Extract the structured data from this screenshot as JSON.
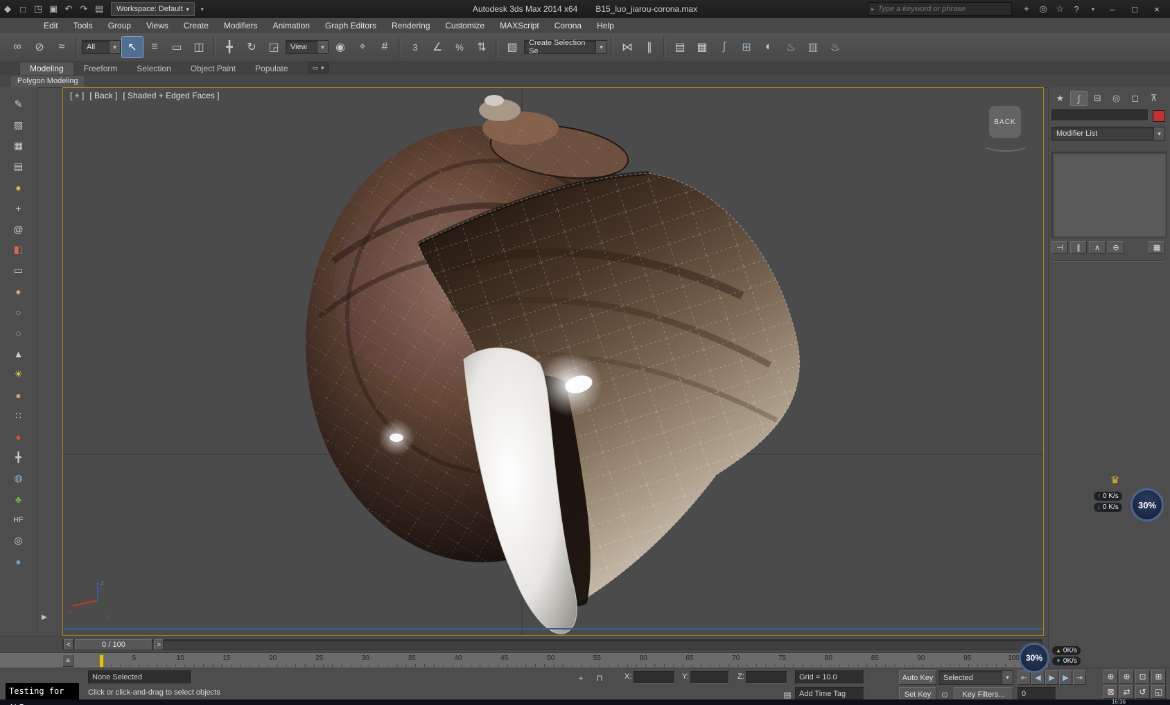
{
  "title_bar": {
    "app_title": "Autodesk 3ds Max 2014 x64",
    "file_name": "B15_luo_jiarou-corona.max",
    "workspace": "Workspace: Default",
    "search_placeholder": "Type a keyword or phrase",
    "search_icon": "▸",
    "qat": {
      "app": "◆",
      "new": "□",
      "open": "◳",
      "save": "▣",
      "undo": "↶",
      "redo": "↷",
      "folder": "▤",
      "dropdown": "▾"
    },
    "info": {
      "target": "⌖",
      "community": "◎",
      "star": "☆",
      "help": "?",
      "chevron": "▾"
    },
    "win": {
      "min": "–",
      "max": "□",
      "close": "×"
    }
  },
  "menu": {
    "items": [
      "Edit",
      "Tools",
      "Group",
      "Views",
      "Create",
      "Modifiers",
      "Animation",
      "Graph Editors",
      "Rendering",
      "Customize",
      "MAXScript",
      "Corona",
      "Help"
    ]
  },
  "toolbar": {
    "filter": "All",
    "coord": "View",
    "selset": "Create Selection Se",
    "arrow": "▾",
    "g": {
      "link": "∞",
      "unlink": "⊘",
      "bind": "≈",
      "select": "↖",
      "byname": "≡",
      "rect": "▭",
      "wincross": "◫",
      "move": "╋",
      "rotate": "↻",
      "scale": "◲",
      "pivot": "◉",
      "manip": "⌖",
      "kbd": "#",
      "snap": "3",
      "angle": "∠",
      "pct": "%",
      "spin": "⇅",
      "sets": "▧",
      "mirror": "⋈",
      "align": "∥",
      "layers": "▤",
      "ribbon": "▦",
      "curve": "∫",
      "schem": "⊞",
      "mat": "◐",
      "rset": "♨",
      "rfw": "▥",
      "render": "♨"
    }
  },
  "ribbon": {
    "tabs": [
      "Modeling",
      "Freeform",
      "Selection",
      "Object Paint",
      "Populate"
    ],
    "subtab": "Polygon Modeling",
    "chevron": "▾",
    "pill": "▭"
  },
  "left_toolbar": {
    "glyphs": [
      "✎",
      "▨",
      "▦",
      "▤",
      "●",
      "+",
      "@",
      "◧",
      "▭",
      "●",
      "○",
      "◌",
      "▲",
      "☀",
      "●",
      "∷",
      "●",
      "╋",
      "◍",
      "♣",
      "HF",
      "◎",
      "●"
    ],
    "flyout": "▶"
  },
  "viewport": {
    "menu": "[ + ]",
    "view": "[ Back ]",
    "shading": "[ Shaded + Edged Faces ]",
    "cube": "BACK",
    "ax": "x",
    "ay": "y",
    "az": "z"
  },
  "panel": {
    "tabs": {
      "create": "★",
      "modify": "∫",
      "hierarchy": "⊟",
      "motion": "◎",
      "display": "◻",
      "utils": "⊼"
    },
    "modifier_list": "Modifier List",
    "arrow": "▾",
    "stack_buttons": [
      "⊣",
      "∥",
      "∧",
      "⊖",
      "▦"
    ]
  },
  "timeline": {
    "slider": "0 / 100",
    "prev": "<",
    "next": ">",
    "mini": "≡",
    "ticks": [
      "5",
      "10",
      "15",
      "20",
      "25",
      "30",
      "35",
      "40",
      "45",
      "50",
      "55",
      "60",
      "65",
      "70",
      "75",
      "80",
      "85",
      "90",
      "95",
      "100"
    ]
  },
  "status": {
    "selection": "None Selected",
    "prompt": "Click or click-and-drag to select objects",
    "tag": "Add Time Tag",
    "tag_icon": "▤",
    "x": "X:",
    "y": "Y:",
    "z": "Z:",
    "gr": "Grid = 10.0",
    "autokey": "Auto Key",
    "setkey": "Set Key",
    "selset": "Selected",
    "filters": "Key Filters...",
    "frame": "0",
    "absicon": "⌖",
    "lock": "⊓",
    "keyicon": "⊙",
    "t_start": "⇤",
    "t_prev": "◀",
    "t_play": "▶",
    "t_next": "▶",
    "t_end": "⇥",
    "nav": [
      "⊕",
      "⊛",
      "⊡",
      "⊞",
      "⊠",
      "⇄",
      "↺",
      "◱"
    ]
  },
  "overlays": {
    "watermark": "Testing for ALI",
    "b1": {
      "pct": "30%",
      "up": "0 K/s",
      "down": "0 K/s",
      "crown": "♛",
      "ua": "↑",
      "da": "↓"
    },
    "b2": {
      "pct": "30%",
      "up": "0K/s",
      "down": "0K/s",
      "ua": "▲",
      "da": "▼"
    },
    "clock": "16:36"
  }
}
